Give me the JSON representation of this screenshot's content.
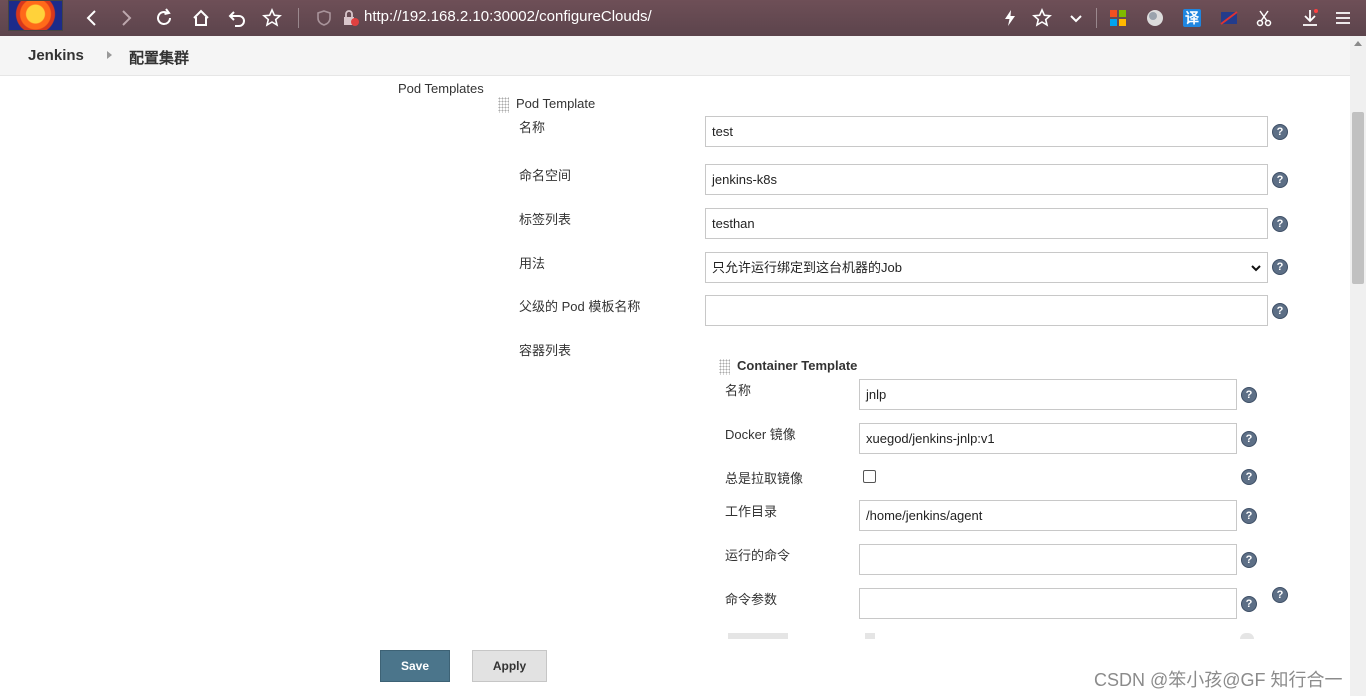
{
  "browser": {
    "url": "http://192.168.2.10:30002/configureClouds/",
    "translate_label": "译"
  },
  "breadcrumb": {
    "root": "Jenkins",
    "current": "配置集群"
  },
  "pod_templates": {
    "section_label": "Pod Templates",
    "template_title": "Pod Template",
    "fields": {
      "name": {
        "label": "名称",
        "value": "test"
      },
      "namespace": {
        "label": "命名空间",
        "value": "jenkins-k8s"
      },
      "labels": {
        "label": "标签列表",
        "value": "testhan"
      },
      "usage": {
        "label": "用法",
        "value": "只允许运行绑定到这台机器的Job"
      },
      "parent": {
        "label": "父级的 Pod 模板名称",
        "value": ""
      },
      "containers": {
        "label": "容器列表"
      }
    }
  },
  "container_template": {
    "title": "Container Template",
    "fields": {
      "name": {
        "label": "名称",
        "value": "jnlp"
      },
      "image": {
        "label": "Docker 镜像",
        "value": "xuegod/jenkins-jnlp:v1"
      },
      "always_pull": {
        "label": "总是拉取镜像",
        "checked": false
      },
      "workdir": {
        "label": "工作目录",
        "value": "/home/jenkins/agent"
      },
      "command": {
        "label": "运行的命令",
        "value": ""
      },
      "args": {
        "label": "命令参数",
        "value": ""
      }
    }
  },
  "actions": {
    "save": "Save",
    "apply": "Apply"
  },
  "help_glyph": "?",
  "watermark": "CSDN @笨小孩@GF 知行合一",
  "colors": {
    "toolbar": "#5c444c",
    "save_button": "#4b758b",
    "help_icon": "#5d6f86"
  }
}
